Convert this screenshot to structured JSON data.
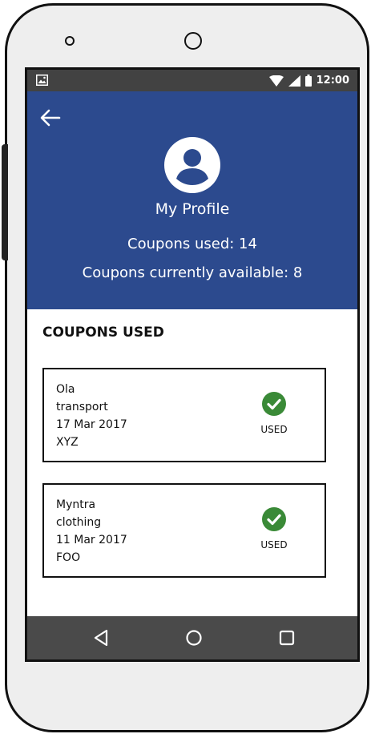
{
  "status_bar": {
    "time": "12:00"
  },
  "header": {
    "title": "My Profile",
    "coupons_used_text": "Coupons used: 14",
    "coupons_available_text": "Coupons currently available: 8"
  },
  "section": {
    "title": "COUPONS USED"
  },
  "coupons": [
    {
      "brand": "Ola",
      "category": "transport",
      "date": "17 Mar 2017",
      "code": "XYZ",
      "status": "USED"
    },
    {
      "brand": "Myntra",
      "category": "clothing",
      "date": "11 Mar 2017",
      "code": "FOO",
      "status": "USED"
    }
  ],
  "colors": {
    "header_background": "#2c4a8e",
    "used_check": "#3a8a37",
    "status_bar": "#424242",
    "nav_bar": "#4a4a4a"
  },
  "icons": {
    "back": "arrow-back-icon",
    "avatar": "account-circle-icon",
    "used": "check-circle-icon",
    "nav_back": "triangle-back-icon",
    "nav_home": "circle-home-icon",
    "nav_recents": "square-recents-icon"
  }
}
